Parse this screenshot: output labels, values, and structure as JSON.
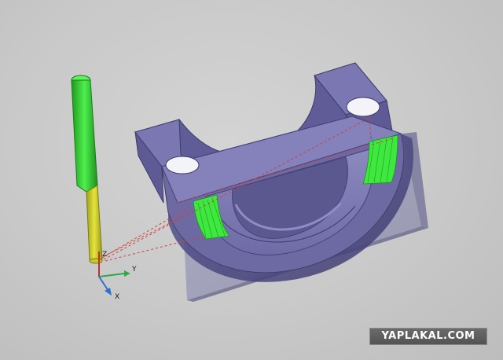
{
  "viewport": {
    "background_color": "#c9c9c9",
    "part_color": "#6d6aa3",
    "toolpath_color": "#39e639",
    "tool_shank_color": "#3dd93d",
    "tool_flute_color": "#d4d42a",
    "link_line_color": "#d04040"
  },
  "triad": {
    "x_label": "X",
    "y_label": "Y",
    "z_label": "Z",
    "x_color": "#2d6fd0",
    "y_color": "#2fa84a",
    "z_color": "#c03030"
  },
  "watermark": {
    "text": "YAPLAKAL.COM"
  }
}
